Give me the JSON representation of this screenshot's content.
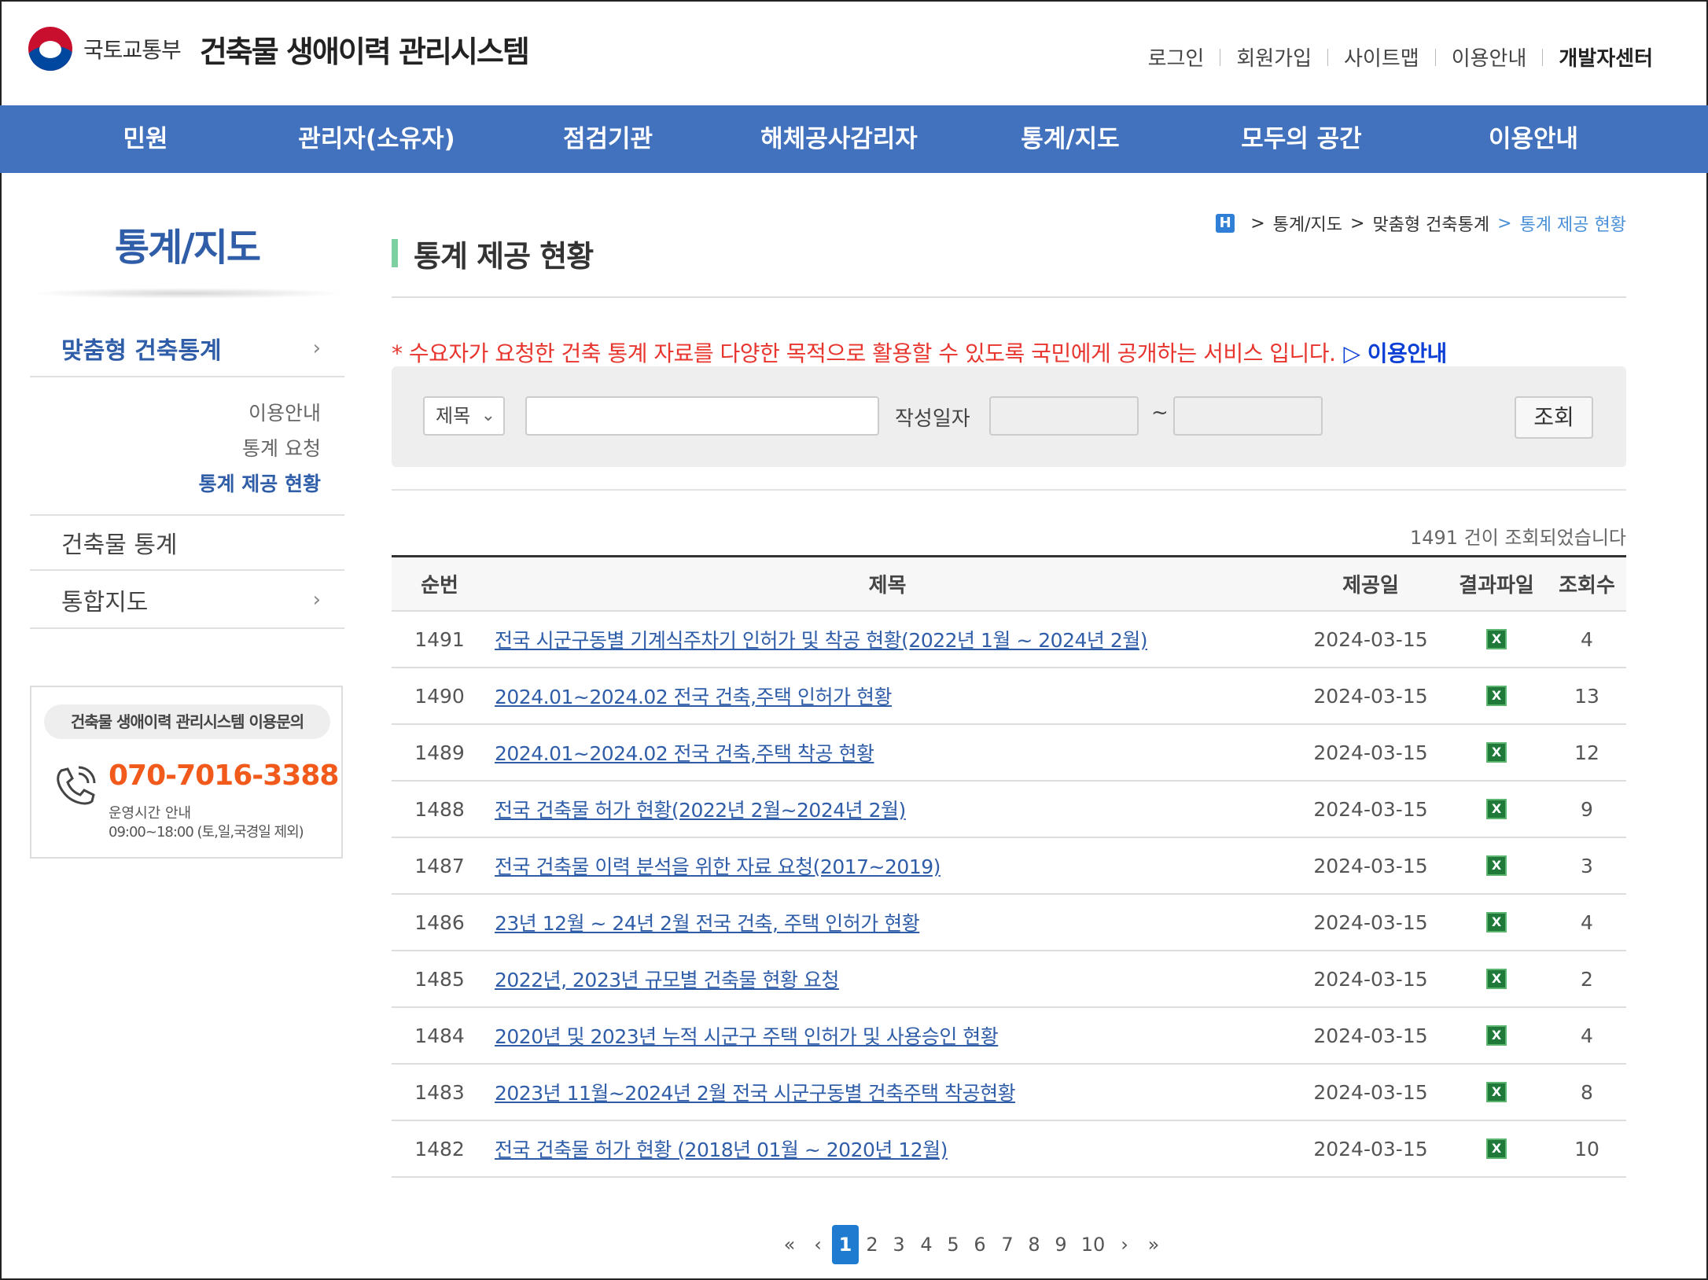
{
  "header": {
    "ministry": "국토교통부",
    "system_name": "건축물 생애이력 관리시스템",
    "util": [
      "로그인",
      "회원가입",
      "사이트맵",
      "이용안내"
    ],
    "dev_center": "개발자센터"
  },
  "gnb": [
    "민원",
    "관리자(소유자)",
    "점검기관",
    "해체공사감리자",
    "통계/지도",
    "모두의 공간",
    "이용안내"
  ],
  "lnb": {
    "title": "통계/지도",
    "items": [
      {
        "label": "맞춤형 건축통계",
        "chevron": "›"
      },
      {
        "label": "건축물 통계"
      },
      {
        "label": "통합지도",
        "chevron": "›"
      }
    ],
    "sub": [
      "이용안내",
      "통계 요청",
      "통계 제공 현황"
    ],
    "contact": {
      "title": "건축물 생애이력 관리시스템 이용문의",
      "phone": "070-7016-3388",
      "hours_label": "운영시간 안내",
      "hours": "09:00~18:00 (토,일,국경일 제외)"
    }
  },
  "breadcrumb": {
    "home": "H",
    "items": [
      "통계/지도",
      "맞춤형 건축통계",
      "통계 제공 현황"
    ]
  },
  "page_title": "통계 제공 현황",
  "notice": {
    "text": "* 수요자가 요청한 건축 통계 자료를 다양한 목적으로 활용할 수 있도록 국민에게 공개하는 서비스 입니다.",
    "link": "▷ 이용안내"
  },
  "search": {
    "select_value": "제목",
    "keyword": "",
    "date_label": "작성일자",
    "tilde": "~",
    "button": "조회"
  },
  "result_count": "1491 건이 조회되었습니다",
  "table": {
    "headers": [
      "순번",
      "제목",
      "제공일",
      "결과파일",
      "조회수"
    ],
    "rows": [
      {
        "no": "1491",
        "title": "전국 시군구동별 기계식주차기 인허가 및 착공 현황(2022년 1월 ~ 2024년 2월)",
        "date": "2024-03-15",
        "views": "4"
      },
      {
        "no": "1490",
        "title": "2024.01~2024.02 전국 건축,주택 인허가 현황",
        "date": "2024-03-15",
        "views": "13"
      },
      {
        "no": "1489",
        "title": "2024.01~2024.02 전국 건축,주택 착공 현황",
        "date": "2024-03-15",
        "views": "12"
      },
      {
        "no": "1488",
        "title": "전국 건축물 허가 현황(2022년 2월~2024년 2월)",
        "date": "2024-03-15",
        "views": "9"
      },
      {
        "no": "1487",
        "title": "전국 건축물 이력 분석을 위한 자료 요청(2017~2019)",
        "date": "2024-03-15",
        "views": "3"
      },
      {
        "no": "1486",
        "title": "23년 12월 ~ 24년 2월 전국 건축, 주택 인허가 현황",
        "date": "2024-03-15",
        "views": "4"
      },
      {
        "no": "1485",
        "title": "2022년, 2023년 규모별 건축물 현황 요청",
        "date": "2024-03-15",
        "views": "2"
      },
      {
        "no": "1484",
        "title": "2020년 및 2023년 누적 시군구 주택 인허가 및 사용승인 현황",
        "date": "2024-03-15",
        "views": "4"
      },
      {
        "no": "1483",
        "title": "2023년 11월~2024년 2월 전국 시군구동별 건축주택 착공현황",
        "date": "2024-03-15",
        "views": "8"
      },
      {
        "no": "1482",
        "title": "전국 건축물 허가 현황 (2018년 01월 ~ 2020년 12월)",
        "date": "2024-03-15",
        "views": "10"
      }
    ]
  },
  "pagination": {
    "first": "«",
    "prev": "‹",
    "pages": [
      "1",
      "2",
      "3",
      "4",
      "5",
      "6",
      "7",
      "8",
      "9",
      "10"
    ],
    "current": "1",
    "next": "›",
    "last": "»"
  },
  "colors": {
    "gnb_bg": "#4271bd",
    "accent_blue": "#2f5da8",
    "notice_red": "#e8352e",
    "phone_orange": "#f25a1c",
    "pager_active": "#1e7bd0"
  },
  "icons": {
    "file": "excel-file-icon",
    "phone": "phone-icon",
    "home": "home-icon"
  }
}
